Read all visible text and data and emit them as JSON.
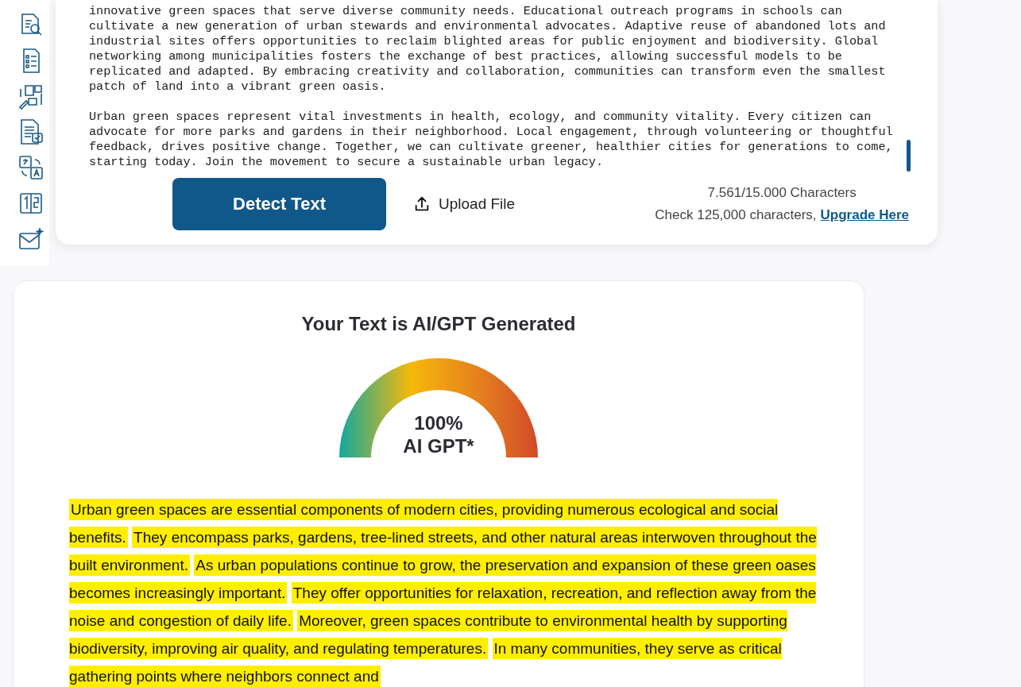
{
  "editor": {
    "paragraphs": [
      "innovative green spaces that serve diverse community needs. Educational outreach programs in schools can cultivate a new generation of urban stewards and environmental advocates. Adaptive reuse of abandoned lots and industrial sites offers opportunities to reclaim blighted areas for public enjoyment and biodiversity. Global networking among municipalities fosters the exchange of best practices, allowing successful models to be replicated and adapted. By embracing creativity and collaboration, communities can transform even the smallest patch of land into a vibrant green oasis.",
      "Urban green spaces represent vital investments in health, ecology, and community vitality. Every citizen can advocate for more parks and gardens in their neighborhood. Local engagement, through volunteering or thoughtful feedback, drives positive change. Together, we can cultivate greener, healthier cities for generations to come, starting today. Join the movement to secure a sustainable urban legacy."
    ]
  },
  "actions": {
    "detect_button": "Detect Text",
    "upload_button": "Upload File",
    "counter": "7.561/15.000 Characters",
    "upgrade_note": "Check 125,000 characters,",
    "upgrade_link": "Upgrade Here"
  },
  "result": {
    "title": "Your Text is AI/GPT Generated",
    "gauge": {
      "level": 1,
      "value": "100%",
      "label": "AI GPT*"
    },
    "sentences": [
      {
        "text": "Urban green spaces are essential components of modern cities, providing numerous ecological and social benefits.",
        "highlighted": true
      },
      {
        "text": "They encompass parks, gardens, tree-lined streets, and other natural areas interwoven throughout the built environment.",
        "highlighted": true
      },
      {
        "text": "As urban populations continue to grow, the preservation and expansion of these green oases becomes increasingly important.",
        "highlighted": true
      },
      {
        "text": "They offer opportunities for relaxation, recreation, and reflection away from the noise and congestion of daily life.",
        "highlighted": true
      },
      {
        "text": "Moreover, green spaces contribute to environmental health by supporting biodiversity, improving air quality, and regulating temperatures.",
        "highlighted": true
      },
      {
        "text": "In many communities, they serve as critical gathering points where neighbors connect and",
        "highlighted": true
      }
    ]
  }
}
